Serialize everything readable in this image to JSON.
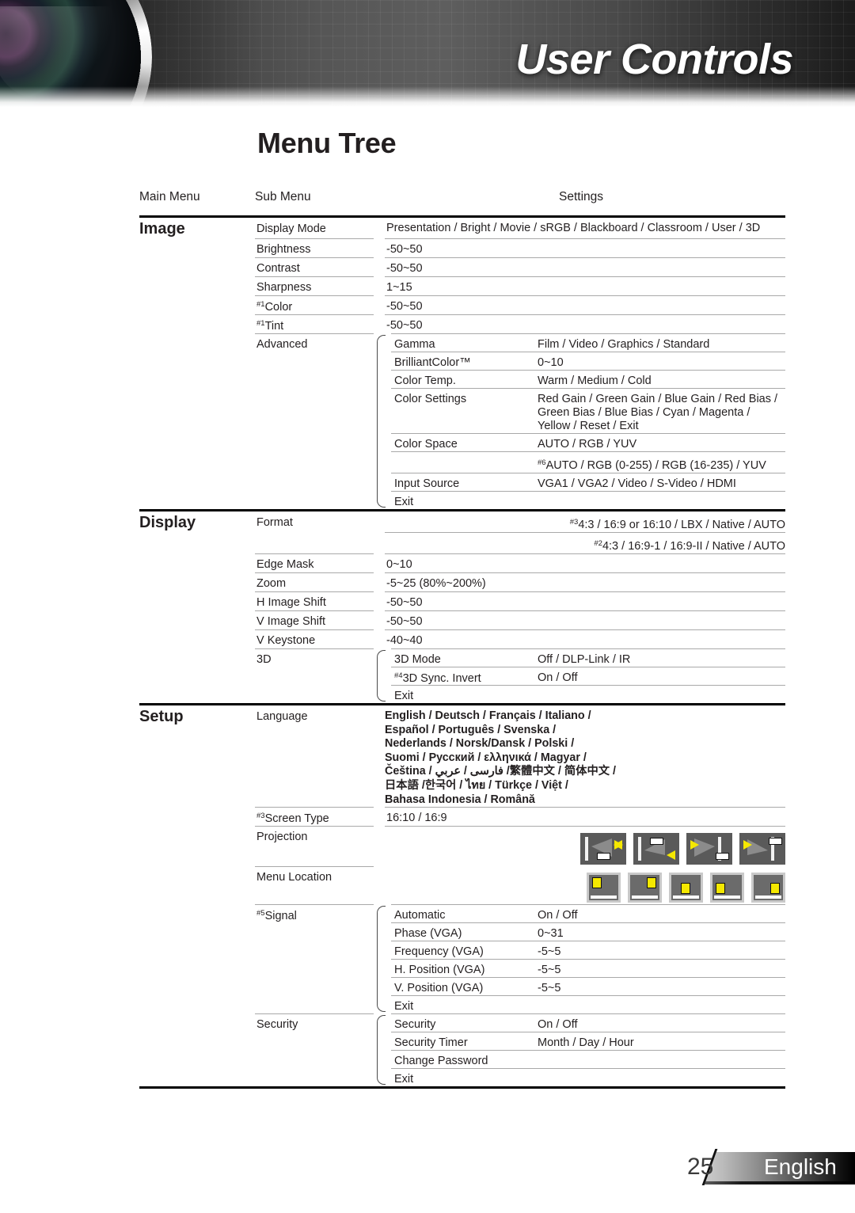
{
  "banner": {
    "title": "User Controls"
  },
  "page": {
    "title": "Menu Tree"
  },
  "columns": {
    "main": "Main Menu",
    "sub": "Sub Menu",
    "settings": "Settings"
  },
  "sections": [
    {
      "name": "Image",
      "rows": [
        {
          "sub": "Display Mode",
          "set": "Presentation / Bright / Movie / sRGB / Blackboard / Classroom / User / 3D"
        },
        {
          "sub": "Brightness",
          "set": "-50~50"
        },
        {
          "sub": "Contrast",
          "set": "-50~50"
        },
        {
          "sub": "Sharpness",
          "set": "1~15"
        },
        {
          "sup": "#1",
          "sub": "Color",
          "set": "-50~50"
        },
        {
          "sup": "#1",
          "sub": "Tint",
          "set": "-50~50"
        }
      ],
      "advanced": {
        "label": "Advanced",
        "items": [
          {
            "name": "Gamma",
            "value": "Film / Video / Graphics / Standard"
          },
          {
            "name": "BrilliantColor™",
            "value": "0~10"
          },
          {
            "name": "Color Temp.",
            "value": "Warm / Medium / Cold"
          },
          {
            "name": "Color Settings",
            "value": "Red Gain / Green Gain / Blue Gain / Red Bias / Green Bias / Blue Bias / Cyan / Magenta / Yellow / Reset / Exit"
          },
          {
            "name": "Color Space",
            "value": "AUTO / RGB / YUV"
          },
          {
            "name": "",
            "sup": "#6",
            "value": "AUTO / RGB (0-255) / RGB (16-235) / YUV"
          },
          {
            "name": "Input Source",
            "value": "VGA1 / VGA2 / Video / S-Video / HDMI"
          },
          {
            "name": "Exit",
            "value": ""
          }
        ]
      }
    },
    {
      "name": "Display",
      "rows": [
        {
          "sub": "Format",
          "sup_set": "#3",
          "set": "4:3 / 16:9 or 16:10 / LBX / Native / AUTO"
        },
        {
          "sub": "",
          "sup_set": "#2",
          "set": "4:3 / 16:9-1 / 16:9-II / Native / AUTO"
        },
        {
          "sub": "Edge Mask",
          "set": "0~10"
        },
        {
          "sub": "Zoom",
          "set": "-5~25 (80%~200%)"
        },
        {
          "sub": "H Image Shift",
          "set": "-50~50"
        },
        {
          "sub": "V Image Shift",
          "set": "-50~50"
        },
        {
          "sub": "V Keystone",
          "set": "-40~40"
        }
      ],
      "threeD": {
        "label": "3D",
        "items": [
          {
            "name": "3D Mode",
            "value": "Off / DLP-Link / IR"
          },
          {
            "name": "3D Sync. Invert",
            "sup": "#4",
            "value": "On / Off"
          },
          {
            "name": "Exit",
            "value": ""
          }
        ]
      }
    },
    {
      "name": "Setup",
      "language": {
        "label": "Language",
        "lines": [
          "English / Deutsch / Français / Italiano /",
          "Español / Português / Svenska /",
          "Nederlands / Norsk/Dansk / Polski /",
          "Suomi / Русский / ελληνικά / Magyar /",
          "Čeština / فارسی / عربي /繁體中文 / 简体中文 /",
          "日本語 /한국어 / ไทย / Türkçe / Việt /",
          "Bahasa Indonesia / Română"
        ]
      },
      "screen_type": {
        "sup": "#3",
        "label": "Screen Type",
        "value": "16:10 / 16:9"
      },
      "projection": {
        "label": "Projection",
        "icons": [
          "projection-front-table-icon",
          "projection-front-ceiling-icon",
          "projection-rear-table-icon",
          "projection-rear-ceiling-icon"
        ]
      },
      "menu_location": {
        "label": "Menu Location",
        "icons": [
          "menu-position-top-left-icon",
          "menu-position-top-right-icon",
          "menu-position-center-icon",
          "menu-position-bottom-left-icon",
          "menu-position-bottom-right-icon"
        ]
      },
      "signal": {
        "sup": "#5",
        "label": "Signal",
        "items": [
          {
            "name": "Automatic",
            "value": "On / Off"
          },
          {
            "name": "Phase (VGA)",
            "value": "0~31"
          },
          {
            "name": "Frequency (VGA)",
            "value": "-5~5"
          },
          {
            "name": "H. Position (VGA)",
            "value": "-5~5"
          },
          {
            "name": "V. Position (VGA)",
            "value": "-5~5"
          },
          {
            "name": "Exit",
            "value": ""
          }
        ]
      },
      "security": {
        "label": "Security",
        "items": [
          {
            "name": "Security",
            "value": "On / Off"
          },
          {
            "name": "Security Timer",
            "value": "Month / Day / Hour"
          },
          {
            "name": "Change Password",
            "value": ""
          },
          {
            "name": "Exit",
            "value": ""
          }
        ]
      }
    }
  ],
  "footer": {
    "page_number": "25",
    "language": "English"
  },
  "colors": {
    "accent_yellow": "#f5e800",
    "rule": "#a9a9a9",
    "text": "#231f20",
    "icon_bg": "#5a5a5a"
  }
}
